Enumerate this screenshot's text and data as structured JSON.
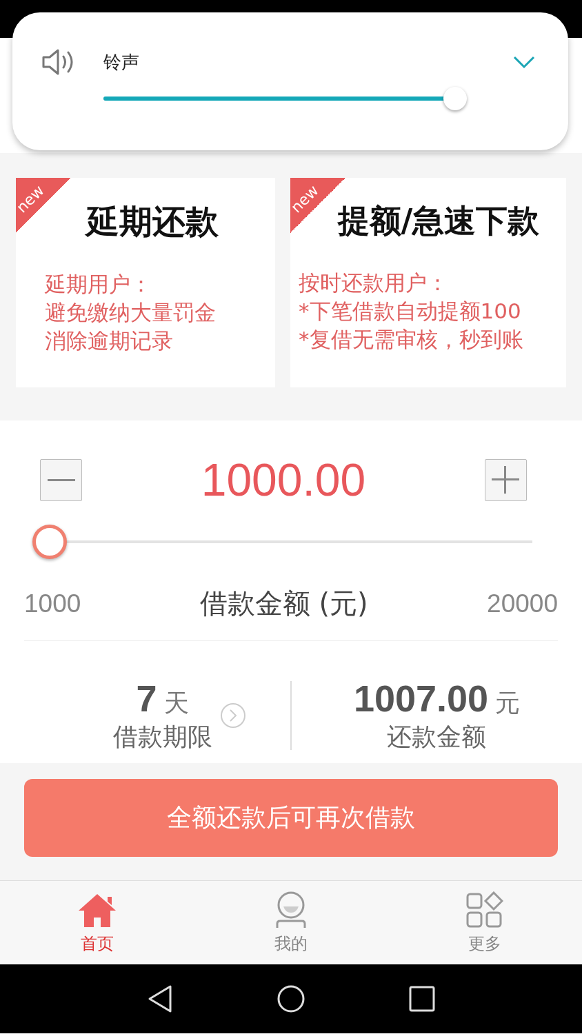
{
  "volume_popup": {
    "label": "铃声",
    "level": 0.97
  },
  "promo_cards": [
    {
      "badge": "new",
      "title": "延期还款",
      "lines": [
        "延期用户：",
        "避免缴纳大量罚金",
        "消除逾期记录"
      ]
    },
    {
      "badge": "new",
      "title": "提额/急速下款",
      "lines": [
        "按时还款用户：",
        "*下笔借款自动提额100",
        "*复借无需审核，秒到账"
      ]
    }
  ],
  "amount": {
    "value": "1000.00",
    "level": 0,
    "min": "1000",
    "max": "20000",
    "label": "借款金额 (元)"
  },
  "term": {
    "value": "7",
    "unit": "天",
    "label": "借款期限"
  },
  "repay": {
    "value": "1007.00",
    "unit": "元",
    "label": "还款金额"
  },
  "action_button": "全额还款后可再次借款",
  "tabs": [
    {
      "label": "首页",
      "kind": "home",
      "selected": true
    },
    {
      "label": "我的",
      "kind": "profile",
      "selected": false
    },
    {
      "label": "更多",
      "kind": "more",
      "selected": false
    }
  ]
}
